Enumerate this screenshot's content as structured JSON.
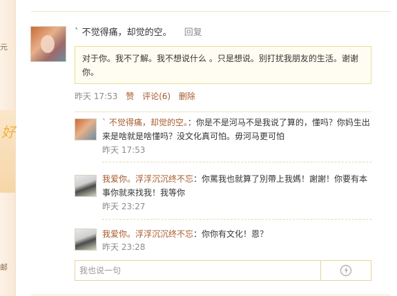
{
  "left_strip": {
    "chars": [
      "元",
      "好",
      "邮"
    ]
  },
  "post": {
    "author": "` 不觉得痛，却觉的空。",
    "reply_label": "回复",
    "content": "对于你。我不了解。我不想说什么 。只是想说。别打扰我朋友的生活。谢谢你。",
    "time": "昨天 17:53",
    "like_label": "赞",
    "comment_label": "评论(6)",
    "delete_label": "删除"
  },
  "comments": [
    {
      "name": "` 不觉得痛，却觉的空。",
      "text": "：你是不是河马不是我说了算的，懂吗？你妈生出来是啥就是啥懂吗？没文化真可怕。毋河马更可怕",
      "time": "昨天 17:53",
      "avatar": "girl"
    },
    {
      "name": "我爱你。浮浮沉沉终不忘",
      "text": "：你罵我也就算了別帶上我媽！謝謝！你要有本事你就來找我！我等你",
      "time": "昨天 23:27",
      "avatar": "doll"
    },
    {
      "name": "我爱你。浮浮沉沉终不忘",
      "text": "：你你有文化！恩？",
      "time": "昨天 23:28",
      "avatar": "doll"
    }
  ],
  "reply_box": {
    "placeholder": "我也说一句",
    "emoji_icon": "smiley-icon",
    "emoji_color": "#b0b0b0"
  }
}
